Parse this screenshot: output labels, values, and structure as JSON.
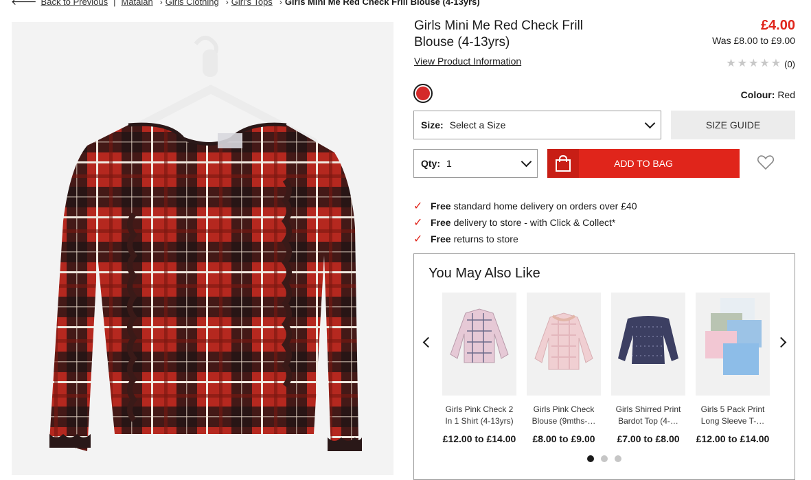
{
  "breadcrumb": {
    "back": "Back to Previous",
    "items": [
      "Matalan",
      "Girls Clothing",
      "Girl's Tops"
    ],
    "current": "Girls Mini Me Red Check Frill Blouse (4-13yrs)"
  },
  "product": {
    "title": "Girls Mini Me Red Check Frill Blouse (4-13yrs)",
    "price": "£4.00",
    "was_price": "Was £8.00 to £9.00",
    "view_info": "View Product Information",
    "rating_count": "(0)",
    "colour_label": "Colour:",
    "colour_value": "Red",
    "size_label": "Size:",
    "size_value": "Select a Size",
    "size_guide": "SIZE GUIDE",
    "qty_label": "Qty:",
    "qty_value": "1",
    "add_to_bag": "ADD TO BAG"
  },
  "benefits": [
    {
      "bold": "Free",
      "text": "standard home delivery on orders over £40"
    },
    {
      "bold": "Free",
      "text": "delivery to store - with Click & Collect*"
    },
    {
      "bold": "Free",
      "text": "returns to store"
    }
  ],
  "recommendations": {
    "heading": "You May Also Like",
    "items": [
      {
        "name": "Girls Pink Check 2 In 1 Shirt (4-13yrs)",
        "price": "£12.00 to £14.00"
      },
      {
        "name": "Girls Pink Check Blouse (9mths-…",
        "price": "£8.00 to £9.00"
      },
      {
        "name": "Girls Shirred Print Bardot Top (4-…",
        "price": "£7.00 to £8.00"
      },
      {
        "name": "Girls 5 Pack Print Long Sleeve T-…",
        "price": "£12.00 to £14.00"
      }
    ]
  },
  "colors": {
    "accent": "#e0251b",
    "swatch": "#d42a2a"
  }
}
